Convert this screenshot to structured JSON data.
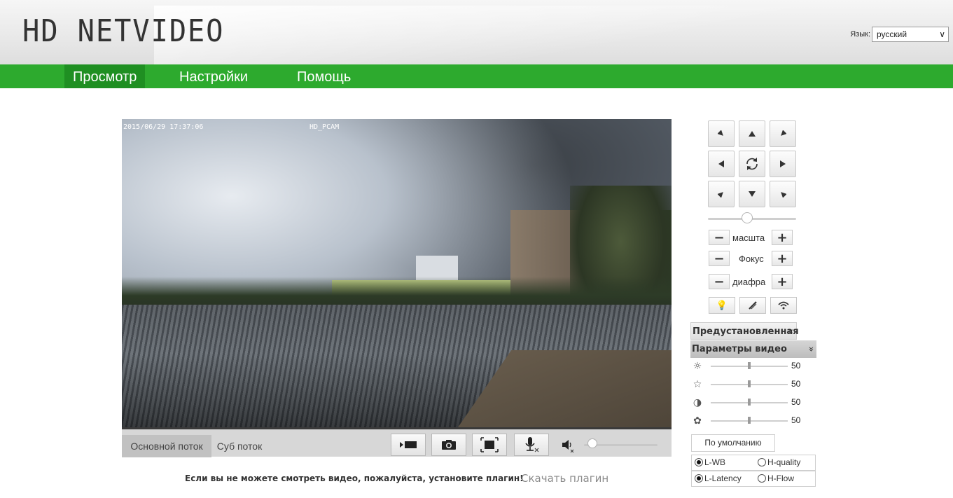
{
  "header": {
    "logo": "HD NETVIDEO",
    "language_label": "Язык:",
    "language_value": "русский"
  },
  "nav": {
    "items": [
      "Просмотр",
      "Настройки",
      "Помощь"
    ],
    "active": "Просмотр"
  },
  "video": {
    "osd_datetime": "2015/06/29 17:37:06",
    "osd_camera_name": "HD_PCAM",
    "tabs": [
      "Основной поток",
      "Суб поток"
    ],
    "active_tab": "Основной поток",
    "toolbar_icons": [
      "record-icon",
      "snapshot-icon",
      "fullscreen-icon",
      "microphone-muted-icon",
      "speaker-muted-icon"
    ],
    "volume_level": 0
  },
  "plugin": {
    "message": "Если вы не можете смотреть видео, пожалуйста, установите плагин!",
    "link": "Скачать плагин"
  },
  "ptz": {
    "directions": [
      "up-left",
      "up",
      "up-right",
      "left",
      "center",
      "right",
      "down-left",
      "down",
      "down-right"
    ],
    "speed_level": 0.4,
    "zoom_label": "масшта",
    "focus_label": "Фокус",
    "iris_label": "диафра",
    "aux_icons": [
      "light-bulb-icon",
      "wiper-icon",
      "ir-icon"
    ]
  },
  "presets": {
    "label": "Предустановленная",
    "arrow": "«"
  },
  "video_params": {
    "label": "Параметры видео",
    "arrow": "»",
    "rows": [
      {
        "icon": "brightness-icon",
        "glyph": "☼",
        "value": "50",
        "level": 0.5
      },
      {
        "icon": "saturation-icon",
        "glyph": "☆",
        "value": "50",
        "level": 0.5
      },
      {
        "icon": "contrast-icon",
        "glyph": "◑",
        "value": "50",
        "level": 0.5
      },
      {
        "icon": "hue-icon",
        "glyph": "✿",
        "value": "50",
        "level": 0.5
      }
    ],
    "default_button": "По умолчанию",
    "options_row1": [
      "L-WB",
      "H-quality"
    ],
    "options_row1_selected": "L-WB",
    "options_row2": [
      "L-Latency",
      "H-Flow"
    ],
    "options_row2_selected": "L-Latency"
  },
  "colors": {
    "nav_green": "#2daa2e",
    "nav_active": "#1f8f22"
  }
}
